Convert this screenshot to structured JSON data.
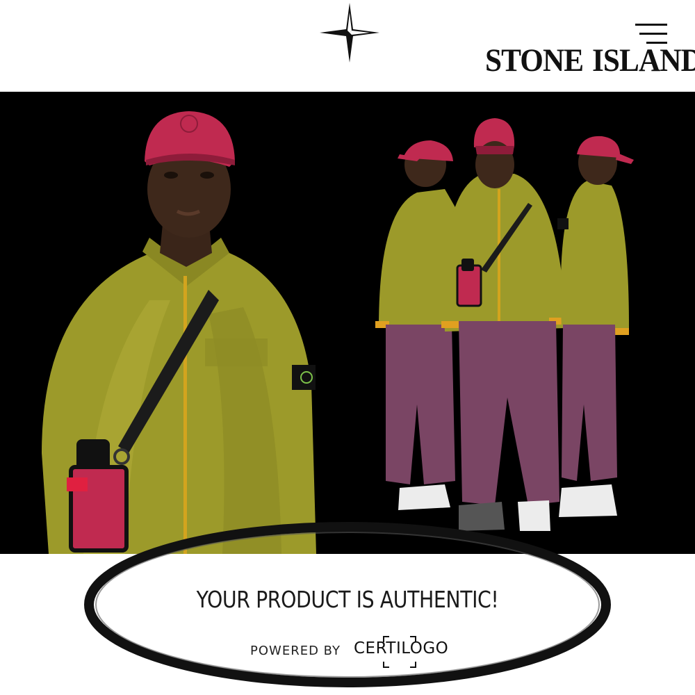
{
  "header": {
    "brand_left": "STONE",
    "brand_right": "ISLAND",
    "logo_icon": "compass-rose-icon",
    "menu_icon": "hamburger-menu-icon"
  },
  "hero": {
    "image": "product-campaign-photo",
    "background": "#000000"
  },
  "verification": {
    "message": "YOUR PRODUCT IS AUTHENTIC!",
    "powered_by_label": "POWERED BY",
    "provider": "CERTILOGO"
  },
  "colors": {
    "jacket": "#9c9a2a",
    "cap": "#c02a50",
    "pants": "#7a4564",
    "ring": "#1a1a1a"
  }
}
